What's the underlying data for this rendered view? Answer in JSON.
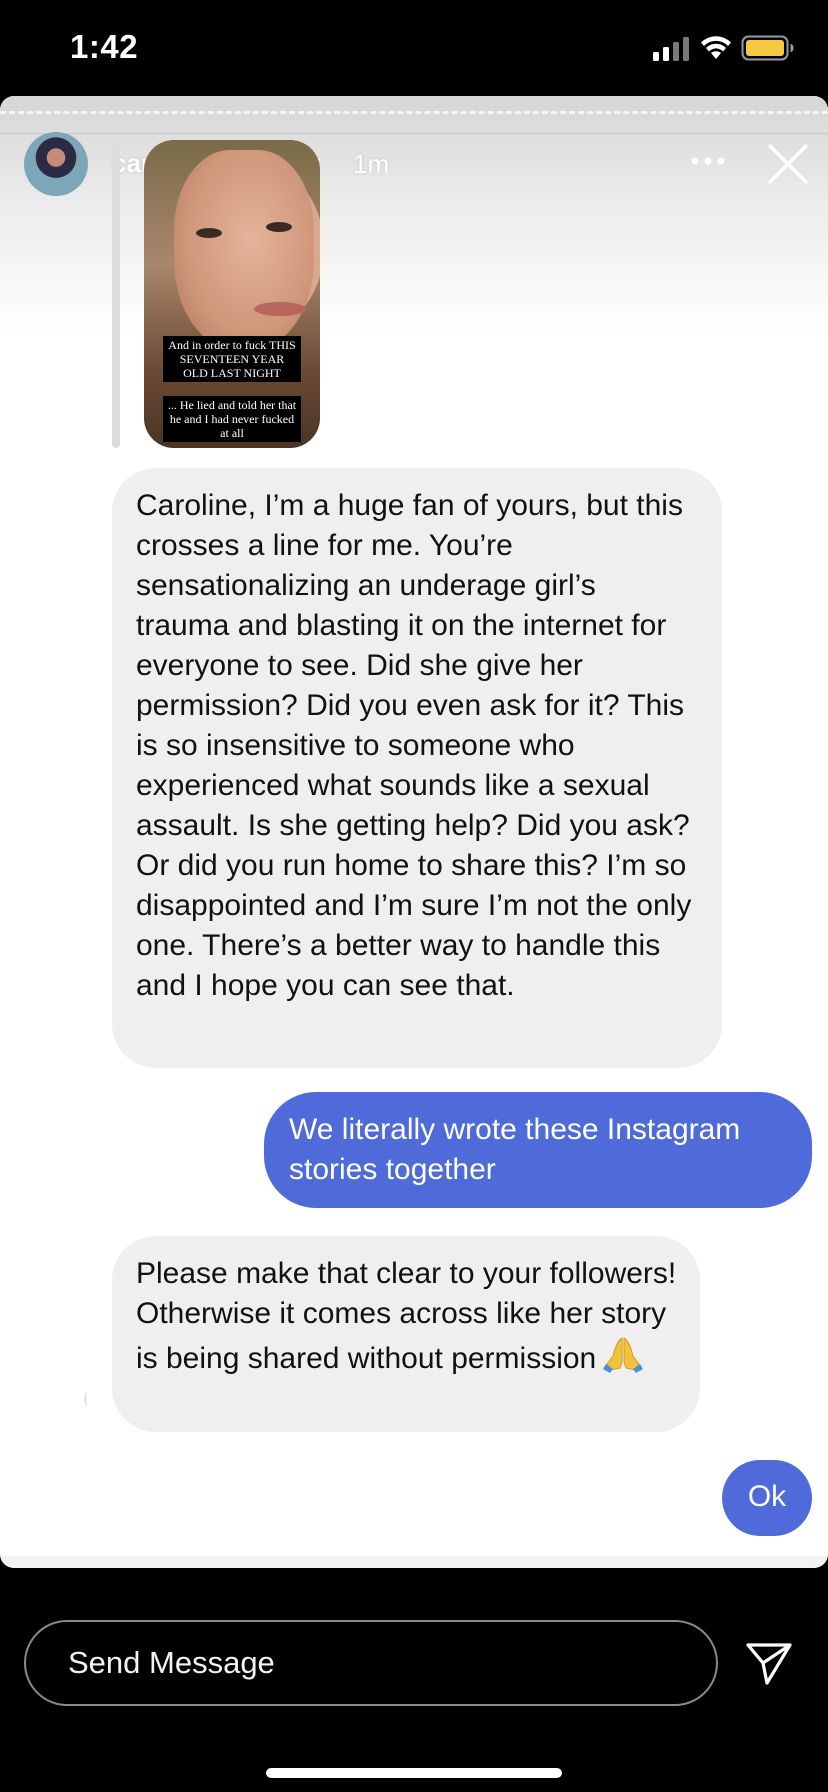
{
  "status_bar": {
    "time": "1:42",
    "signal_icon": "cellular-signal-icon",
    "wifi_icon": "wifi-icon",
    "battery_icon": "battery-icon",
    "battery_color": "#f5c842"
  },
  "story_header": {
    "username": "carolinecalloway",
    "time_ago": "1m",
    "more_icon": "more-horizontal-icon",
    "close_icon": "close-icon"
  },
  "story_preview": {
    "caption_top": "And in order to fuck THIS\nSEVENTEEN YEAR\nOLD LAST NIGHT",
    "caption_bottom": "... He lied and told her that\nhe and I had never fucked\nat all"
  },
  "messages": [
    {
      "direction": "incoming",
      "text": "Caroline, I’m a huge fan of yours, but this crosses a line for me. You’re sensationalizing an underage girl’s trauma and blasting it on the internet for everyone to see. Did she give her permission? Did you even ask for it? This is so insensitive to someone who experienced what sounds like a sexual assault. Is she getting help? Did you ask? Or did you run home to share this? I’m so disappointed and I’m sure I’m not the only one. There’s a better way to handle this and I hope you can see that."
    },
    {
      "direction": "outgoing",
      "text": "We literally wrote these Instagram stories together"
    },
    {
      "direction": "incoming",
      "text": "Please make that clear to your followers! Otherwise it comes across like her story is being shared without permission",
      "emoji_icon": "folded-hands-icon"
    },
    {
      "direction": "outgoing",
      "text": "Ok"
    }
  ],
  "composer": {
    "placeholder": "Send Message",
    "send_icon": "send-paper-plane-icon"
  },
  "colors": {
    "outgoing_bubble": "#4f6ad9",
    "incoming_bubble": "#efefef"
  }
}
